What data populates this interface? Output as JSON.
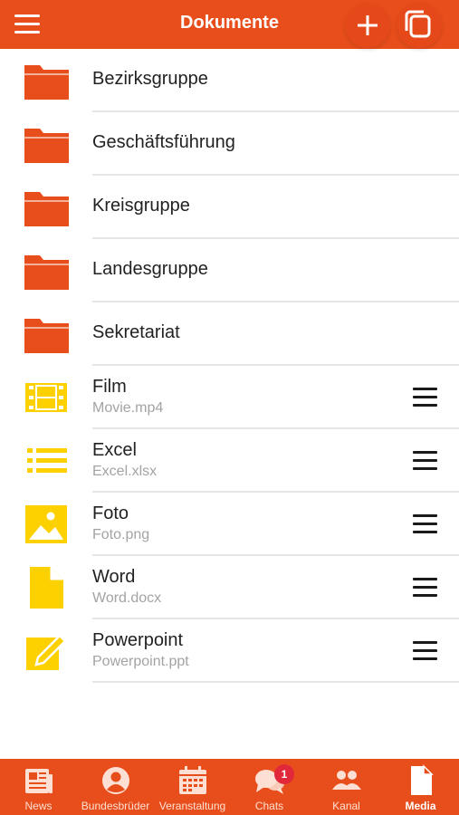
{
  "header": {
    "title": "Dokumente",
    "menu_icon": "hamburger-menu-icon",
    "add_icon": "plus-icon",
    "copy_icon": "copy-icon",
    "brand_color": "#e84e1b"
  },
  "folders": [
    {
      "name": "Bezirksgruppe",
      "icon": "folder-icon"
    },
    {
      "name": "Geschäftsführung",
      "icon": "folder-icon"
    },
    {
      "name": "Kreisgruppe",
      "icon": "folder-icon"
    },
    {
      "name": "Landesgruppe",
      "icon": "folder-icon"
    },
    {
      "name": "Sekretariat",
      "icon": "folder-icon"
    }
  ],
  "files": [
    {
      "name": "Film",
      "filename": "Movie.mp4",
      "icon": "film-icon"
    },
    {
      "name": "Excel",
      "filename": "Excel.xlsx",
      "icon": "list-icon"
    },
    {
      "name": "Foto",
      "filename": "Foto.png",
      "icon": "image-icon"
    },
    {
      "name": "Word",
      "filename": "Word.docx",
      "icon": "document-icon"
    },
    {
      "name": "Powerpoint",
      "filename": "Powerpoint.ppt",
      "icon": "edit-icon"
    }
  ],
  "colors": {
    "folder": "#e84e1b",
    "file_icon": "#fdd000",
    "subtitle": "#a3a3a3",
    "separator": "#e6e6e6"
  },
  "bottom_nav": {
    "tabs": [
      {
        "label": "News",
        "icon": "newspaper-icon"
      },
      {
        "label": "Bundesbrüder",
        "icon": "user-circle-icon"
      },
      {
        "label": "Veranstaltung",
        "icon": "calendar-icon"
      },
      {
        "label": "Chats",
        "icon": "chat-bubbles-icon"
      },
      {
        "label": "Kanal",
        "icon": "group-icon"
      },
      {
        "label": "Media",
        "icon": "file-icon"
      }
    ],
    "active": "Media",
    "chats_badge": "1"
  }
}
